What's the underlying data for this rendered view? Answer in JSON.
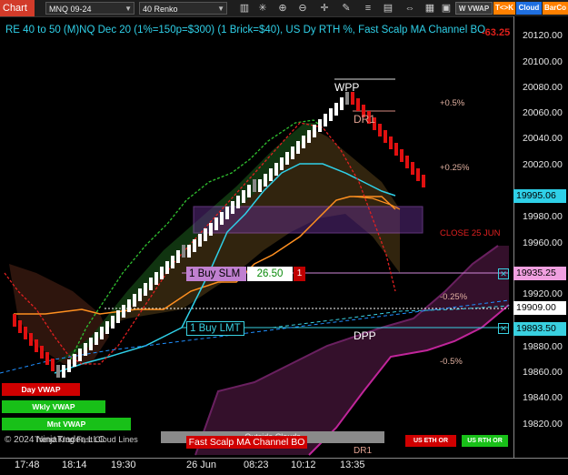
{
  "toolbar": {
    "title": "Chart",
    "instrument": "MNQ 09-24",
    "bar_type": "40 Renko",
    "icons": [
      "bar-chart-icon",
      "settings-icon",
      "zoom-in-icon",
      "zoom-out-icon",
      "crosshair-icon",
      "draw-icon",
      "layers-icon",
      "data-box-icon",
      "scroll-icon"
    ],
    "buttons": {
      "vwap": "W VWAP",
      "tk": "T<>K",
      "cloud": "Cloud",
      "barcolor": "BarCo"
    }
  },
  "chart": {
    "title": "RE 40 to 50 (M)NQ Dec 20 (1%=150p=$300) (1 Brick=$40), US Dy RTH %, Fast Scalp MA Channel BO",
    "title_overlap_value": "-63.25"
  },
  "price_axis": {
    "ticks": [
      "20120.00",
      "20100.00",
      "20080.00",
      "20060.00",
      "20040.00",
      "20020.00",
      "19980.00",
      "19960.00",
      "19920.00",
      "19880.00",
      "19860.00",
      "19840.00",
      "19820.00"
    ],
    "boxes": [
      {
        "label": "19995.06",
        "bg": "#2fd0e8",
        "fg": "#000000"
      },
      {
        "label": "19935.25",
        "bg": "#f0a0e0",
        "fg": "#000000"
      },
      {
        "label": "19909.00",
        "bg": "#ffffff",
        "fg": "#000000"
      },
      {
        "label": "19893.50",
        "bg": "#39d0e0",
        "fg": "#000000"
      }
    ]
  },
  "time_axis": {
    "labels": [
      "17:48",
      "18:14",
      "19:30",
      "26 Jun",
      "08:23",
      "10:12",
      "13:35"
    ]
  },
  "levels": {
    "wpp": "WPP",
    "dr1": "DR1",
    "dpp": "DPP",
    "plus05": "+0.5%",
    "plus025": "+0.25%",
    "close": "CLOSE 25 JUN",
    "minus025": "-0.25%",
    "minus05": "-0.5%",
    "dr1_bottom": "DR1"
  },
  "orders": {
    "buy_slm": {
      "label": "1 Buy SLM",
      "price": "26.50",
      "qty": "1"
    },
    "buy_lmt": {
      "label": "1 Buy LMT"
    }
  },
  "vwap_labels": {
    "day": "Day VWAP",
    "weekly": "Wkly VWAP",
    "monthly": "Mnt VWAP"
  },
  "bottom": {
    "copyright": "© 2024 NinjaTrader, LLC",
    "fast_cloud": "Trend King Fast Cloud Lines",
    "ma_channel": "Fast Scalp MA Channel BO",
    "outside_clouds": "Outside Clouds",
    "us_eth": "US ETH OR",
    "us_rth": "US RTH OR"
  }
}
